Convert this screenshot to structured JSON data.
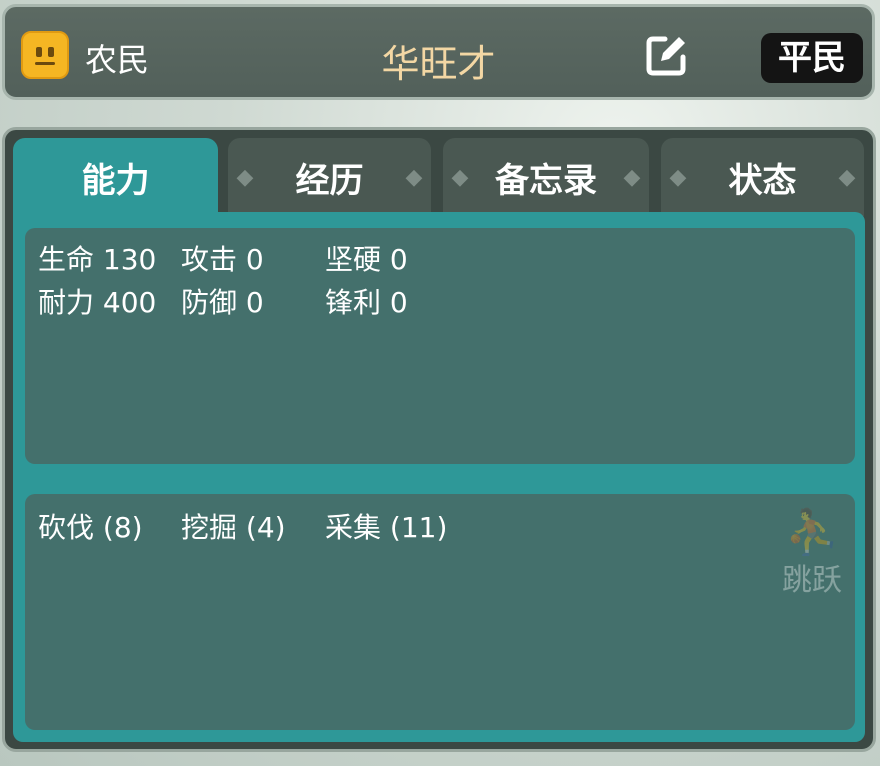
{
  "header": {
    "role": "农民",
    "name": "华旺才",
    "rank": "平民"
  },
  "tabs": [
    {
      "label": "能力",
      "active": true
    },
    {
      "label": "经历",
      "active": false
    },
    {
      "label": "备忘录",
      "active": false
    },
    {
      "label": "状态",
      "active": false
    }
  ],
  "stats": {
    "hp": "生命 130",
    "attack": "攻击 0",
    "hardness": "坚硬 0",
    "stamina": "耐力 400",
    "defense": "防御 0",
    "sharpness": "锋利 0"
  },
  "skills": {
    "chop": "砍伐 (8)",
    "dig": "挖掘 (4)",
    "gather": "采集 (11)"
  },
  "jump_button": "跳跃",
  "colors": {
    "tab_active": "#2e9898",
    "panel_bg": "#3b4843",
    "avatar": "#f5b623",
    "name": "#f3d7a4"
  },
  "icons": [
    "smiley-avatar-icon",
    "edit-icon",
    "tab-ornament-icon",
    "jump-icon"
  ]
}
